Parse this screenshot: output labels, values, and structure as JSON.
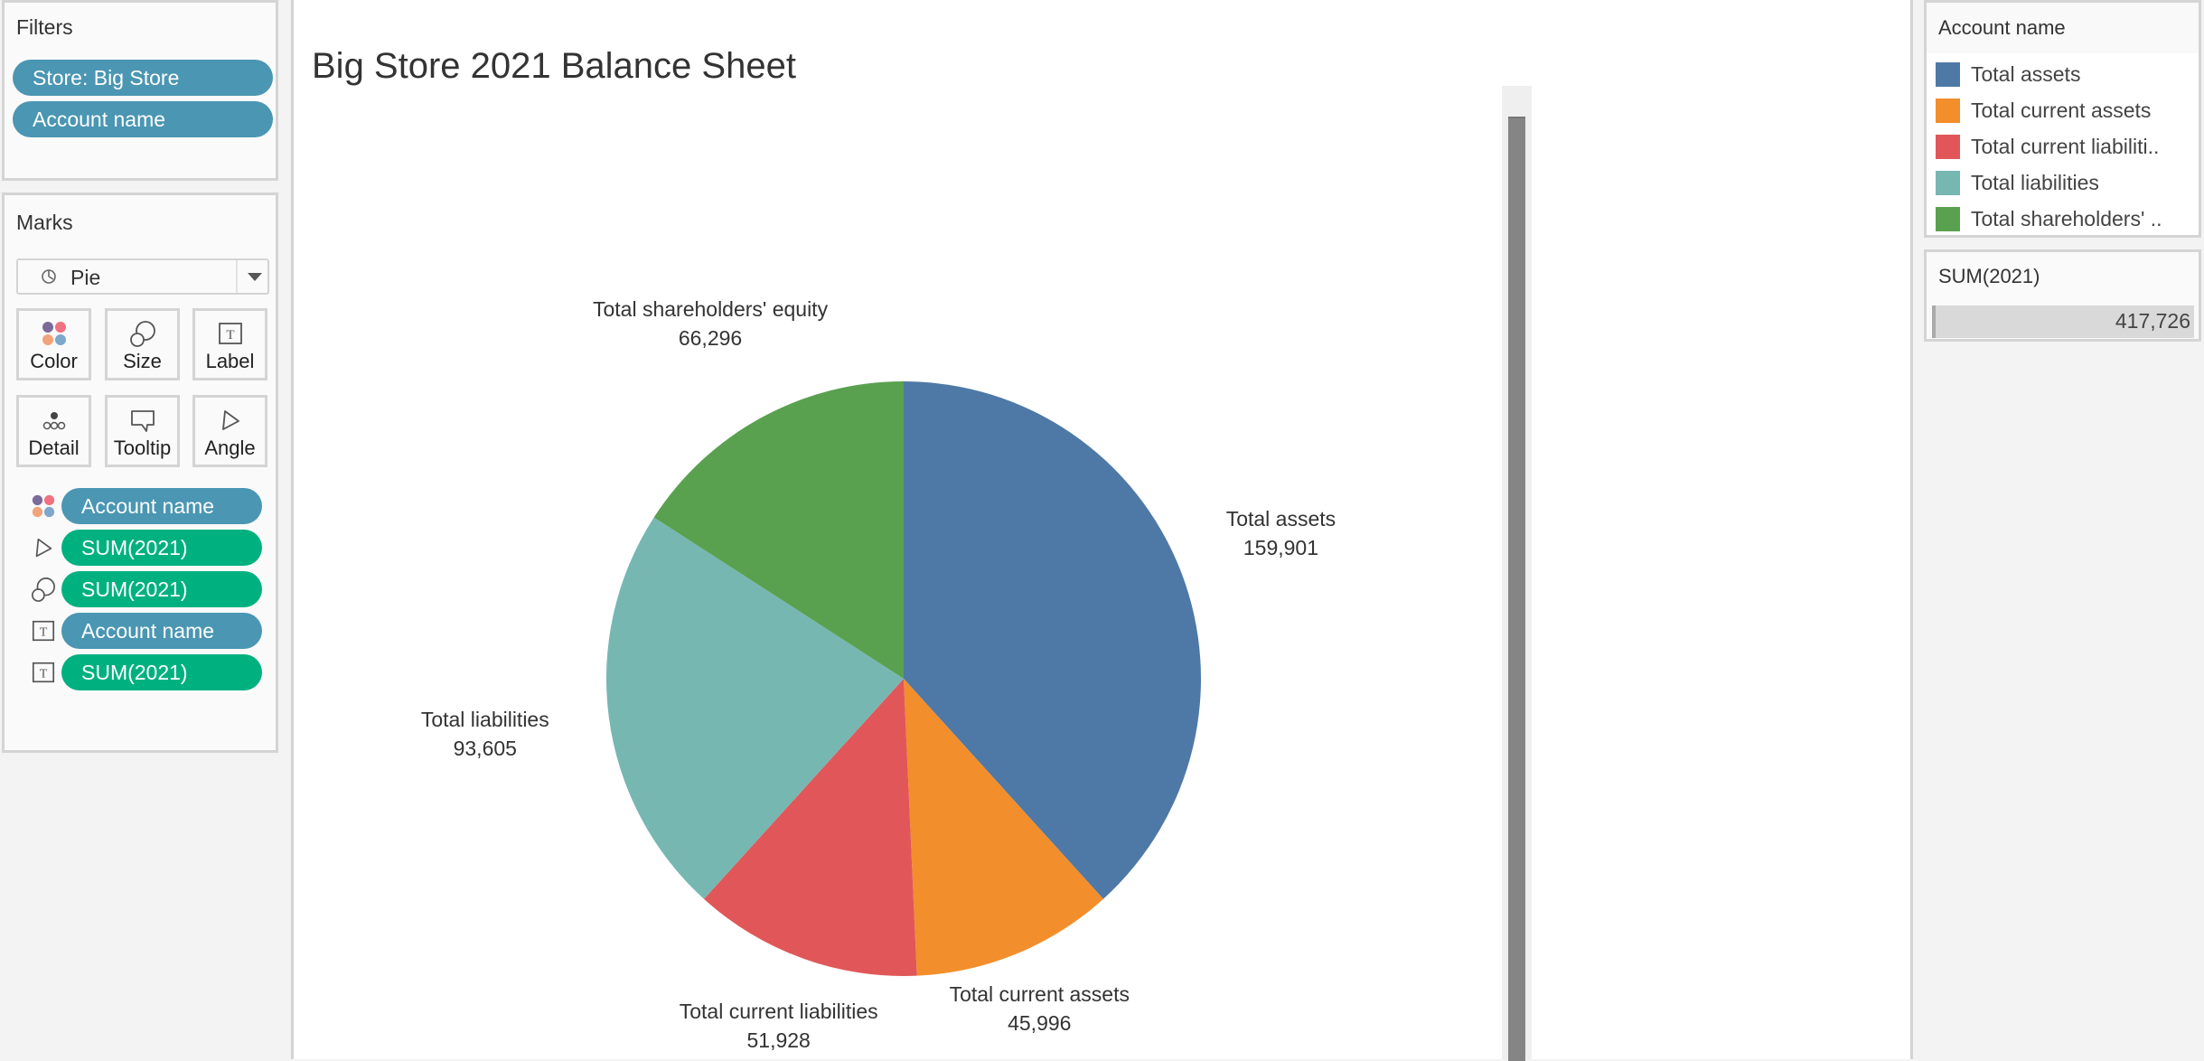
{
  "filters": {
    "title": "Filters",
    "pills": [
      "Store: Big Store",
      "Account name"
    ]
  },
  "marks": {
    "title": "Marks",
    "mark_type": "Pie",
    "cards": [
      {
        "label": "Color",
        "icon": "color-icon"
      },
      {
        "label": "Size",
        "icon": "size-icon"
      },
      {
        "label": "Label",
        "icon": "label-icon"
      },
      {
        "label": "Detail",
        "icon": "detail-icon"
      },
      {
        "label": "Tooltip",
        "icon": "tooltip-icon"
      },
      {
        "label": "Angle",
        "icon": "angle-icon"
      }
    ],
    "shelf": [
      {
        "icon": "color-icon",
        "label": "Account name",
        "kind": "dimension"
      },
      {
        "icon": "angle-icon",
        "label": "SUM(2021)",
        "kind": "measure"
      },
      {
        "icon": "size-icon",
        "label": "SUM(2021)",
        "kind": "measure"
      },
      {
        "icon": "label-icon",
        "label": "Account name",
        "kind": "dimension"
      },
      {
        "icon": "label-icon",
        "label": "SUM(2021)",
        "kind": "measure"
      }
    ]
  },
  "view": {
    "title": "Big Store 2021 Balance Sheet"
  },
  "legend": {
    "title": "Account name",
    "items": [
      {
        "label": "Total assets",
        "color": "#4e79a7"
      },
      {
        "label": "Total current assets",
        "color": "#f28e2b"
      },
      {
        "label": "Total current liabiliti..",
        "color": "#e15759"
      },
      {
        "label": "Total liabilities",
        "color": "#76b7b2"
      },
      {
        "label": "Total shareholders' ..",
        "color": "#59a14f"
      }
    ]
  },
  "size_legend": {
    "title": "SUM(2021)",
    "value": "417,726"
  },
  "chart_data": {
    "type": "pie",
    "title": "Big Store 2021 Balance Sheet",
    "categories": [
      "Total assets",
      "Total current assets",
      "Total current liabilities",
      "Total liabilities",
      "Total shareholders' equity"
    ],
    "values": [
      159901,
      45996,
      51928,
      93605,
      66296
    ],
    "value_labels": [
      "159,901",
      "45,996",
      "51,928",
      "93,605",
      "66,296"
    ],
    "colors": [
      "#4e79a7",
      "#f28e2b",
      "#e15759",
      "#76b7b2",
      "#59a14f"
    ],
    "start_angle": "12 o'clock",
    "direction": "clockwise",
    "total": 417726
  }
}
